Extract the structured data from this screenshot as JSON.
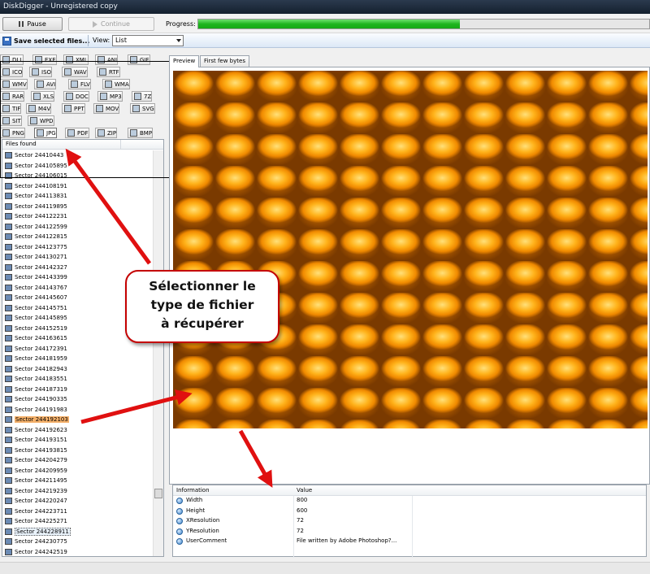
{
  "window": {
    "title": "DiskDigger - Unregistered copy"
  },
  "topbar": {
    "pause_label": "Pause",
    "continue_label": "Continue",
    "progress_label": "Progress:",
    "progress_fraction": 0.58
  },
  "toolbar": {
    "save_label": "Save selected files...",
    "view_label": "View:",
    "view_value": "List"
  },
  "file_types": [
    {
      "label": "DLL",
      "icon": "diamond-icon"
    },
    {
      "label": "EXE",
      "icon": "exe-icon"
    },
    {
      "label": "XML",
      "icon": "document-icon"
    },
    {
      "label": "ANI",
      "icon": "image-icon"
    },
    {
      "label": "GIF",
      "icon": "image-icon"
    },
    {
      "label": "ICO",
      "icon": "image-icon"
    },
    {
      "label": "ISO",
      "icon": "disc-icon"
    },
    {
      "label": "WAV",
      "icon": "audio-icon"
    },
    {
      "label": "RTF",
      "icon": "document-icon"
    },
    {
      "label": "WMV",
      "icon": "video-icon"
    },
    {
      "label": "AVI",
      "icon": "video-icon"
    },
    {
      "label": "FLV",
      "icon": "video-icon"
    },
    {
      "label": "WMA",
      "icon": "audio-icon"
    },
    {
      "label": "RAR",
      "icon": "archive-icon"
    },
    {
      "label": "XLS",
      "icon": "spreadsheet-icon"
    },
    {
      "label": "DOC",
      "icon": "document-icon"
    },
    {
      "label": "MP3",
      "icon": "audio-icon"
    },
    {
      "label": "7Z",
      "icon": "archive-icon"
    },
    {
      "label": "TIF",
      "icon": "image-icon"
    },
    {
      "label": "M4V",
      "icon": "video-icon"
    },
    {
      "label": "PPT",
      "icon": "presentation-icon"
    },
    {
      "label": "MOV",
      "icon": "video-icon"
    },
    {
      "label": "SVG",
      "icon": "vector-icon"
    },
    {
      "label": "SIT",
      "icon": "archive-icon"
    },
    {
      "label": "WPD",
      "icon": "document-icon"
    },
    {
      "label": "PNG",
      "icon": "image-icon"
    },
    {
      "label": "JPG",
      "icon": "image-icon"
    },
    {
      "label": "PDF",
      "icon": "pdf-icon"
    },
    {
      "label": "ZIP",
      "icon": "archive-icon"
    },
    {
      "label": "BMP",
      "icon": "image-icon"
    }
  ],
  "files": {
    "header": "Files found",
    "items": [
      "Sector 24410443",
      "Sector 244105895",
      "Sector 244106015",
      "Sector 244108191",
      "Sector 244113831",
      "Sector 244119895",
      "Sector 244122231",
      "Sector 244122599",
      "Sector 244122815",
      "Sector 244123775",
      "Sector 244130271",
      "Sector 244142327",
      "Sector 244143399",
      "Sector 244143767",
      "Sector 244145607",
      "Sector 244145751",
      "Sector 244145895",
      "Sector 244152519",
      "Sector 244163615",
      "Sector 244172391",
      "Sector 244181959",
      "Sector 244182943",
      "Sector 244183551",
      "Sector 244187319",
      "Sector 244190335",
      "Sector 244191983",
      "Sector 244192103",
      "Sector 244192623",
      "Sector 244193151",
      "Sector 244193815",
      "Sector 244204279",
      "Sector 244209959",
      "Sector 244211495",
      "Sector 244219239",
      "Sector 244220247",
      "Sector 244223711",
      "Sector 244225271",
      "Sector 244228911",
      "Sector 244230775",
      "Sector 244242519"
    ],
    "selected_index": 26,
    "focused_index": 37
  },
  "tabs": {
    "preview": "Preview",
    "first_bytes": "First few bytes"
  },
  "info": {
    "header_info": "Information",
    "header_value": "Value",
    "rows": [
      {
        "key": "Width",
        "value": "800"
      },
      {
        "key": "Height",
        "value": "600"
      },
      {
        "key": "XResolution",
        "value": "72"
      },
      {
        "key": "YResolution",
        "value": "72"
      },
      {
        "key": "UserComment",
        "value": "File written by Adobe Photoshop?..."
      }
    ]
  },
  "annotation": {
    "line1": "Sélectionner le",
    "line2": "type de fichier",
    "line3": "à récupérer"
  },
  "colors": {
    "progress": "#1fb51f",
    "arrow": "#e01010",
    "selected_row": "#f4b06a"
  }
}
